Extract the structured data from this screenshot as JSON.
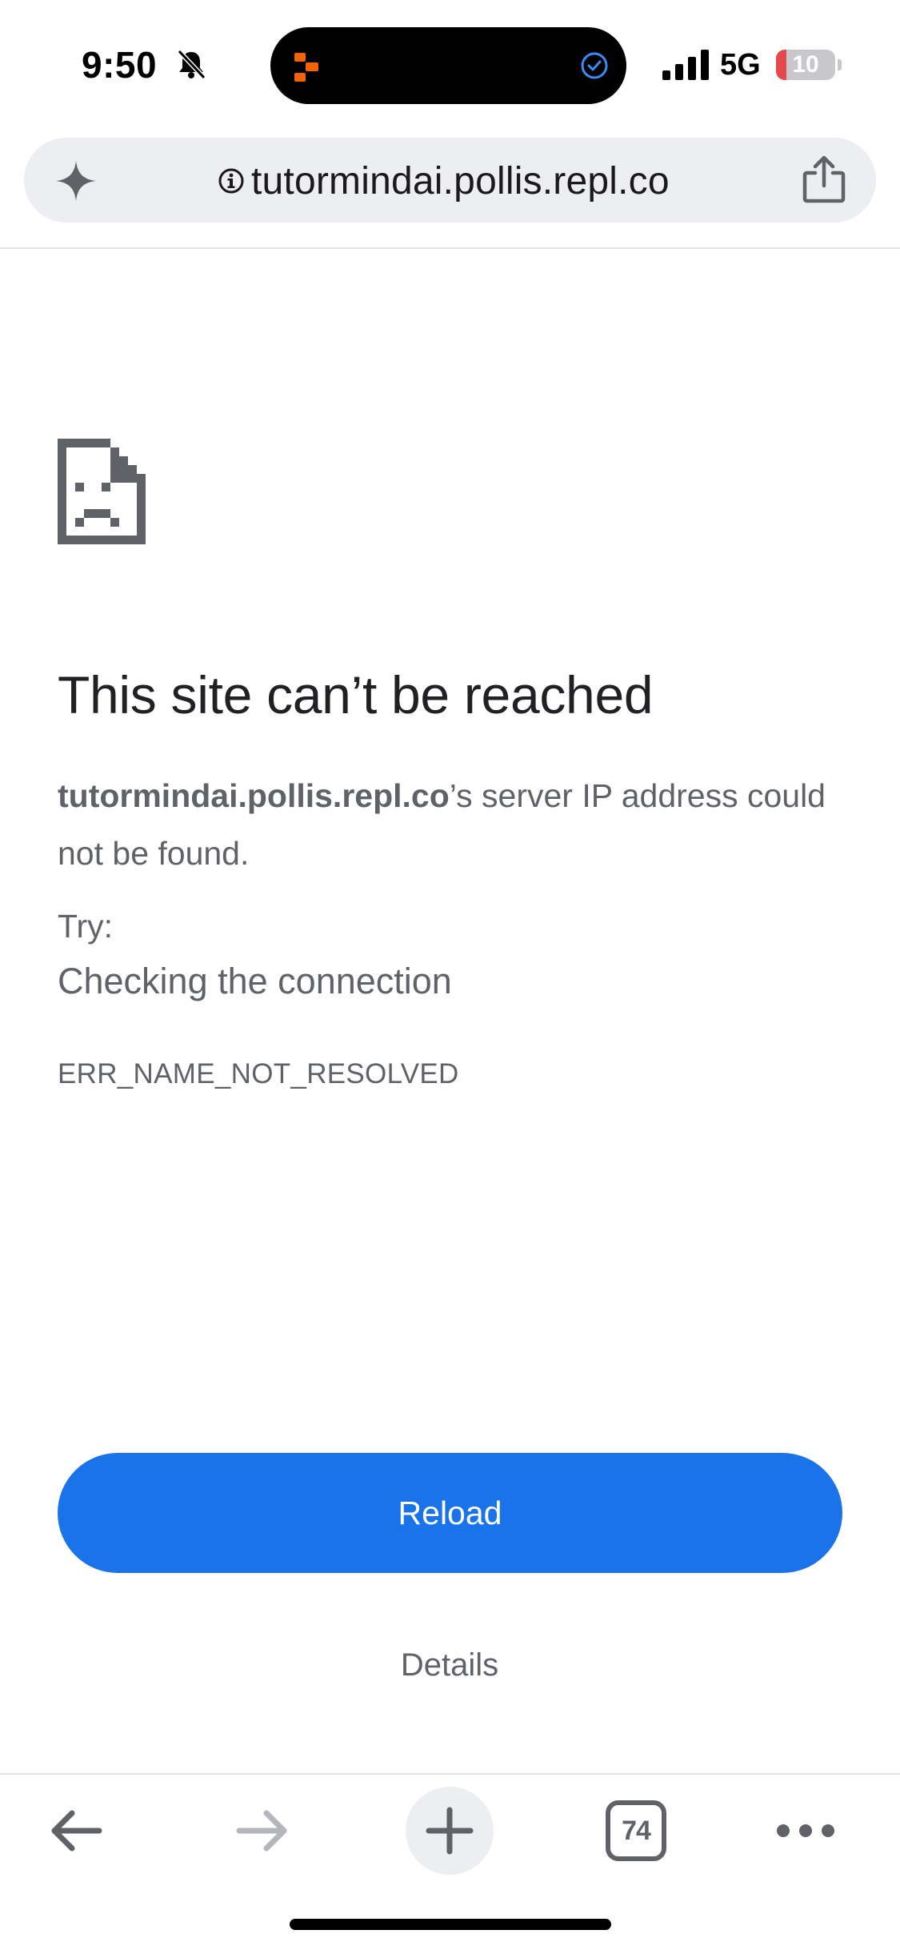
{
  "status_bar": {
    "time": "9:50",
    "network": "5G",
    "battery_level": "10",
    "battery_fraction": 0.1,
    "icons": [
      "bell-slash-icon",
      "app-icon",
      "check-circle-icon",
      "signal-icon",
      "battery-icon"
    ]
  },
  "address_bar": {
    "url": "tutormindai.pollis.repl.co",
    "icons": [
      "sparkle-icon",
      "info-icon",
      "share-icon"
    ]
  },
  "error": {
    "title": "This site can’t be reached",
    "host": "tutormindai.pollis.repl.co",
    "desc_suffix": "’s server IP address could not be found.",
    "try_label": "Try:",
    "try_item": "Checking the connection",
    "code": "ERR_NAME_NOT_RESOLVED",
    "reload_label": "Reload",
    "details_label": "Details"
  },
  "bottom_toolbar": {
    "tab_count": "74",
    "icons": [
      "back-arrow-icon",
      "forward-arrow-icon",
      "plus-icon",
      "tabs-icon",
      "more-icon"
    ]
  },
  "colors": {
    "accent": "#1a73e8",
    "text_primary": "#202124",
    "text_secondary": "#5f6368",
    "battery_low": "#e5484d"
  }
}
